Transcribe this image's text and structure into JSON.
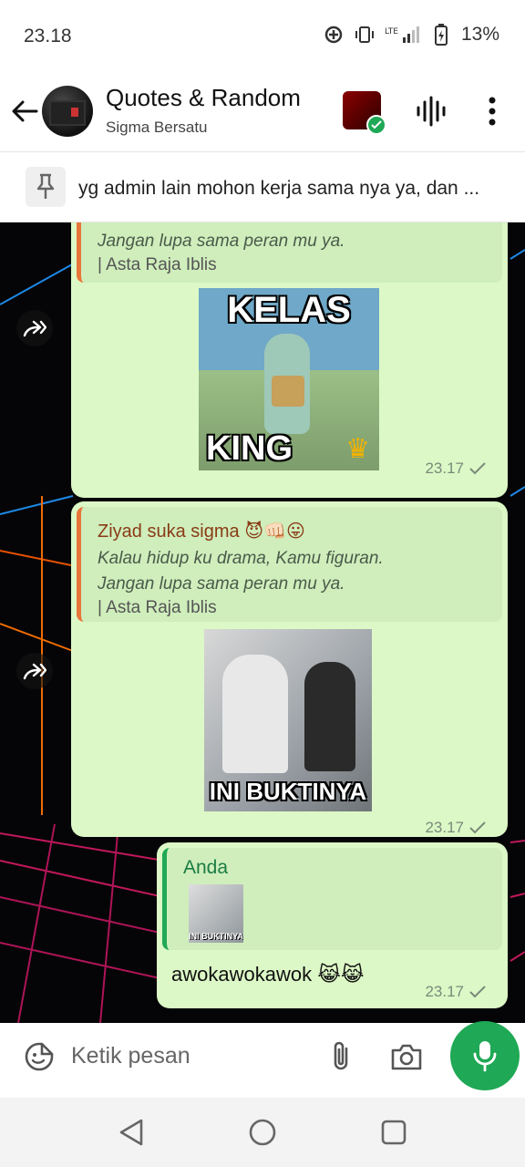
{
  "status_bar": {
    "time": "23.18",
    "network": "LTE",
    "battery": "13%"
  },
  "header": {
    "title": "Quotes & Random",
    "subtitle": "Sigma Bersatu"
  },
  "pinned": {
    "text": "yg admin lain mohon kerja sama nya ya, dan ..."
  },
  "messages": [
    {
      "type": "incoming",
      "quote_text": "Jangan lupa sama peran mu ya.",
      "quote_sub": "Asta Raja Iblis",
      "sticker_text": [
        "KELAS",
        "KING"
      ],
      "time": "23.17"
    },
    {
      "type": "incoming",
      "quote_author": "Ziyad suka sigma",
      "quote_author_emoji": "😈👊🏻😛",
      "quote_text": [
        "Kalau hidup ku drama, Kamu figuran.",
        "Jangan lupa sama peran mu ya."
      ],
      "quote_sub": "Asta Raja Iblis",
      "sticker_text": "INI BUKTINYA",
      "time": "23.17"
    },
    {
      "type": "outgoing",
      "quote_author": "Anda",
      "thumb_text": "INI BUKTINYA",
      "text": "awokawokawok",
      "emoji": "😹😹",
      "time": "23.17"
    }
  ],
  "input": {
    "placeholder": "Ketik pesan"
  },
  "colors": {
    "bubble": "#dcf8c6",
    "quote_bg": "#cfeebc",
    "accent_green": "#1fa855",
    "quote_bar_orange": "#e9753b",
    "author_brown": "#8a3b16"
  },
  "icons": [
    "back-arrow-icon",
    "waveform-icon",
    "more-vert-icon",
    "pin-icon",
    "forward-icon",
    "check-icon",
    "emoji-icon",
    "attach-icon",
    "camera-icon",
    "mic-icon",
    "nav-back-icon",
    "nav-home-icon",
    "nav-recents-icon"
  ]
}
